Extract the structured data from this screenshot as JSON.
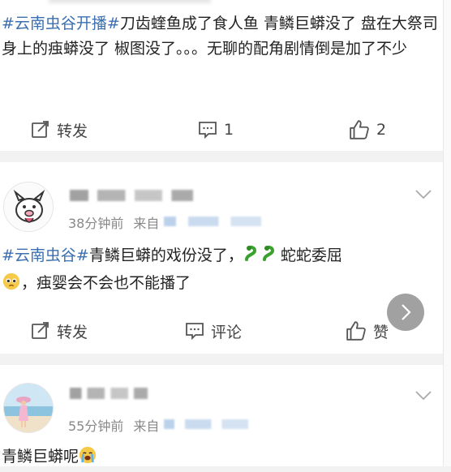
{
  "posts": [
    {
      "topic": "#云南虫谷开播#",
      "text": "刀齿蝰鱼成了食人鱼 青鳞巨蟒没了 盘在大祭司身上的痋蟒没了 椒图没了。。。无聊的配角剧情倒是加了不少",
      "actions": {
        "repost": "转发",
        "comment_count": "1",
        "like_count": "2"
      }
    },
    {
      "time": "38分钟前",
      "source_prefix": "来自",
      "topic": "#云南虫谷#",
      "text1": "青鳞巨蟒的戏份没了，",
      "text2": "蛇蛇委屈",
      "text3": "，痋婴会不会也不能播了",
      "actions": {
        "repost": "转发",
        "comment": "评论",
        "like": "赞"
      }
    },
    {
      "time": "55分钟前",
      "source_prefix": "来自",
      "text": "青鳞巨蟒呢"
    }
  ],
  "icons": {
    "repost": "repost-icon",
    "comment": "comment-icon",
    "like": "thumbs-up-icon",
    "more": "chevron-down-icon",
    "next": "chevron-right-icon"
  },
  "colors": {
    "topic": "#3b6fb0",
    "meta": "#888888",
    "text": "#222222"
  }
}
